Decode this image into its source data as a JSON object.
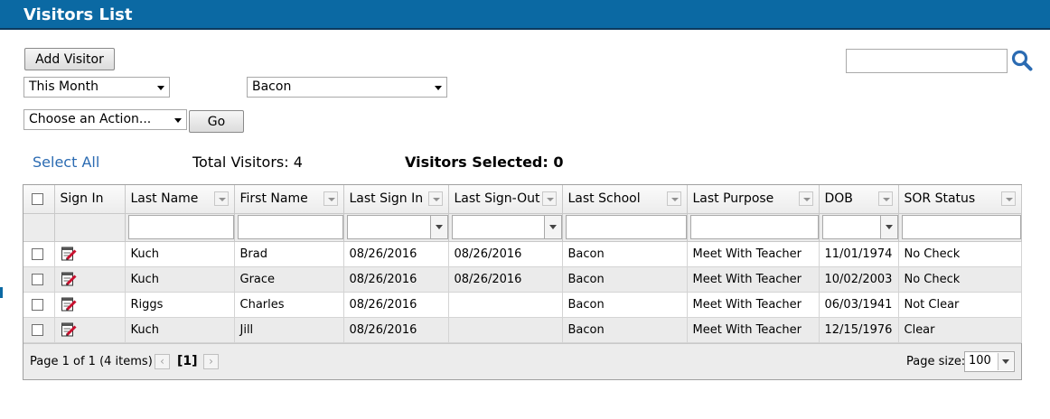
{
  "page": {
    "title": "Visitors List"
  },
  "toolbar": {
    "add_visitor_label": "Add Visitor",
    "period_select": "This Month",
    "school_select": "Bacon",
    "action_select": "Choose an Action...",
    "go_label": "Go"
  },
  "search": {
    "placeholder": ""
  },
  "summary": {
    "select_all": "Select All",
    "total_visitors": "Total Visitors: 4",
    "visitors_selected": "Visitors Selected: 0"
  },
  "grid": {
    "columns": [
      "Sign In",
      "Last Name",
      "First Name",
      "Last Sign In",
      "Last Sign-Out",
      "Last School",
      "Last Purpose",
      "DOB",
      "SOR Status"
    ],
    "rows": [
      {
        "last_name": "Kuch",
        "first_name": "Brad",
        "last_sign_in": "08/26/2016",
        "last_sign_out": "08/26/2016",
        "last_school": "Bacon",
        "last_purpose": "Meet With Teacher",
        "dob": "11/01/1974",
        "sor_status": "No Check"
      },
      {
        "last_name": "Kuch",
        "first_name": "Grace",
        "last_sign_in": "08/26/2016",
        "last_sign_out": "08/26/2016",
        "last_school": "Bacon",
        "last_purpose": "Meet With Teacher",
        "dob": "10/02/2003",
        "sor_status": "No Check"
      },
      {
        "last_name": "Riggs",
        "first_name": "Charles",
        "last_sign_in": "08/26/2016",
        "last_sign_out": "",
        "last_school": "Bacon",
        "last_purpose": "Meet With Teacher",
        "dob": "06/03/1941",
        "sor_status": "Not Clear"
      },
      {
        "last_name": "Kuch",
        "first_name": "Jill",
        "last_sign_in": "08/26/2016",
        "last_sign_out": "",
        "last_school": "Bacon",
        "last_purpose": "Meet With Teacher",
        "dob": "12/15/1976",
        "sor_status": "Clear"
      }
    ]
  },
  "pager": {
    "info": "Page 1 of 1 (4 items)",
    "current_page": "[1]",
    "page_size_label": "Page size:",
    "page_size_value": "100"
  },
  "colors": {
    "title_bar": "#0b69a3",
    "link": "#2b6bb2",
    "search_icon": "#2b6bb2"
  }
}
